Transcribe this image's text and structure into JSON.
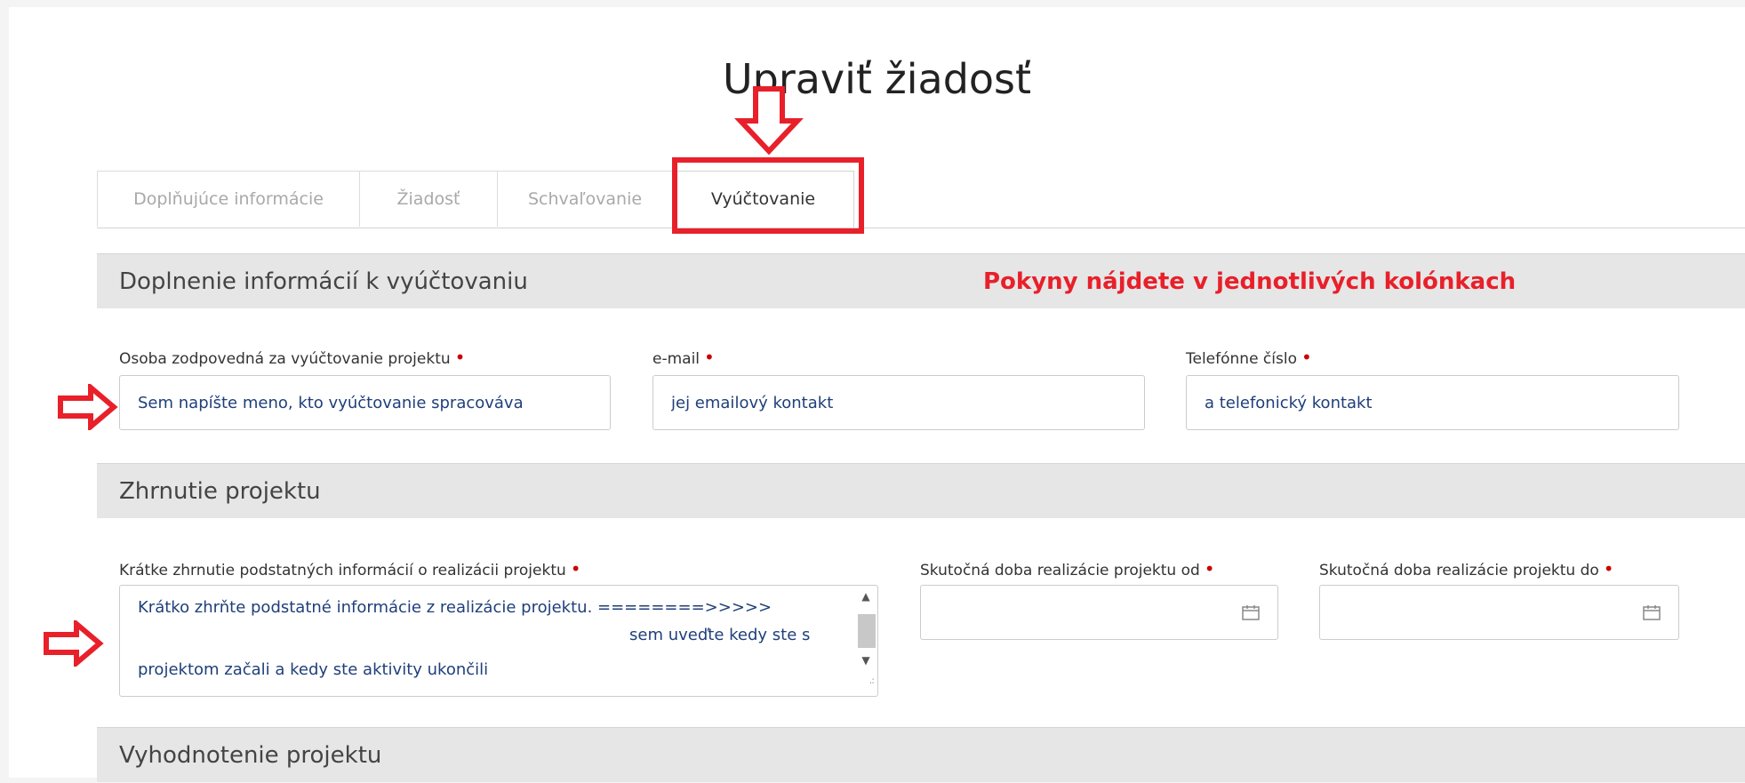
{
  "page_title": "Upraviť žiadosť",
  "tabs": [
    {
      "label": "Doplňujúce informácie"
    },
    {
      "label": "Žiadosť"
    },
    {
      "label": "Schvaľovanie"
    },
    {
      "label": "Vyúčtovanie"
    }
  ],
  "sections": {
    "billing": {
      "title": "Doplnenie informácií k vyúčtovaniu",
      "notice": "Pokyny nájdete v jednotlivých kolónkach",
      "responsible_label": "Osoba zodpovedná za vyúčtovanie projektu",
      "responsible_value": "Sem napíšte meno, kto vyúčtovanie spracováva",
      "email_label": "e-mail",
      "email_value": "jej emailový kontakt",
      "phone_label": "Telefónne číslo",
      "phone_value": "a telefonický kontakt"
    },
    "summary": {
      "title": "Zhrnutie projektu",
      "short_label": "Krátke zhrnutie podstatných informácií o realizácii projektu",
      "short_line1": "Krátko zhrňte podstatné informácie z realizácie projektu. ========>>>>>",
      "short_line2": "sem uveďte kedy ste s",
      "short_line3": "projektom začali a kedy ste aktivity ukončili",
      "from_label": "Skutočná doba realizácie projektu od",
      "to_label": "Skutočná doba realizácie projektu do"
    },
    "evaluation": {
      "title": "Vyhodnotenie projektu"
    }
  },
  "required_mark": "•",
  "colors": {
    "annotation": "#e8202a",
    "required": "#cc0000",
    "field_text": "#1f3f7a",
    "section_bg": "#e6e6e6"
  }
}
